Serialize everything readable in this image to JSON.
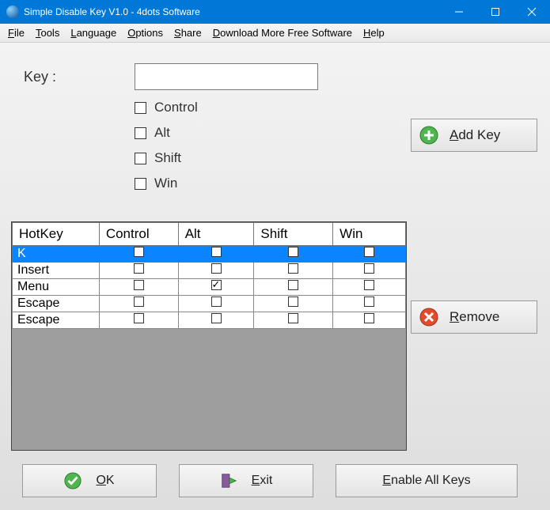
{
  "window": {
    "title": "Simple Disable Key V1.0 - 4dots Software"
  },
  "menu": {
    "file": "File",
    "file_u": "F",
    "tools": "Tools",
    "tools_u": "T",
    "language": "Language",
    "language_u": "L",
    "options": "Options",
    "options_u": "O",
    "share": "Share",
    "share_u": "S",
    "download": "Download More Free Software",
    "download_u": "D",
    "help": "Help",
    "help_u": "H"
  },
  "form": {
    "key_label": "Key :",
    "key_value": "",
    "mod_control": "Control",
    "mod_alt": "Alt",
    "mod_shift": "Shift",
    "mod_win": "Win"
  },
  "buttons": {
    "add_key": "Add Key",
    "add_key_u": "A",
    "remove": "Remove",
    "remove_u": "R",
    "ok": "OK",
    "ok_u": "O",
    "exit": "Exit",
    "exit_u": "E",
    "enable_all": "Enable All Keys",
    "enable_all_u": "E"
  },
  "table": {
    "headers": {
      "hotkey": "HotKey",
      "control": "Control",
      "alt": "Alt",
      "shift": "Shift",
      "win": "Win"
    },
    "rows": [
      {
        "hotkey": "K",
        "control": false,
        "alt": false,
        "shift": false,
        "win": false,
        "selected": true
      },
      {
        "hotkey": "Insert",
        "control": false,
        "alt": false,
        "shift": false,
        "win": false,
        "selected": false
      },
      {
        "hotkey": "Menu",
        "control": false,
        "alt": true,
        "shift": false,
        "win": false,
        "selected": false
      },
      {
        "hotkey": "Escape",
        "control": false,
        "alt": false,
        "shift": false,
        "win": false,
        "selected": false
      },
      {
        "hotkey": "Escape",
        "control": false,
        "alt": false,
        "shift": false,
        "win": false,
        "selected": false
      }
    ]
  }
}
